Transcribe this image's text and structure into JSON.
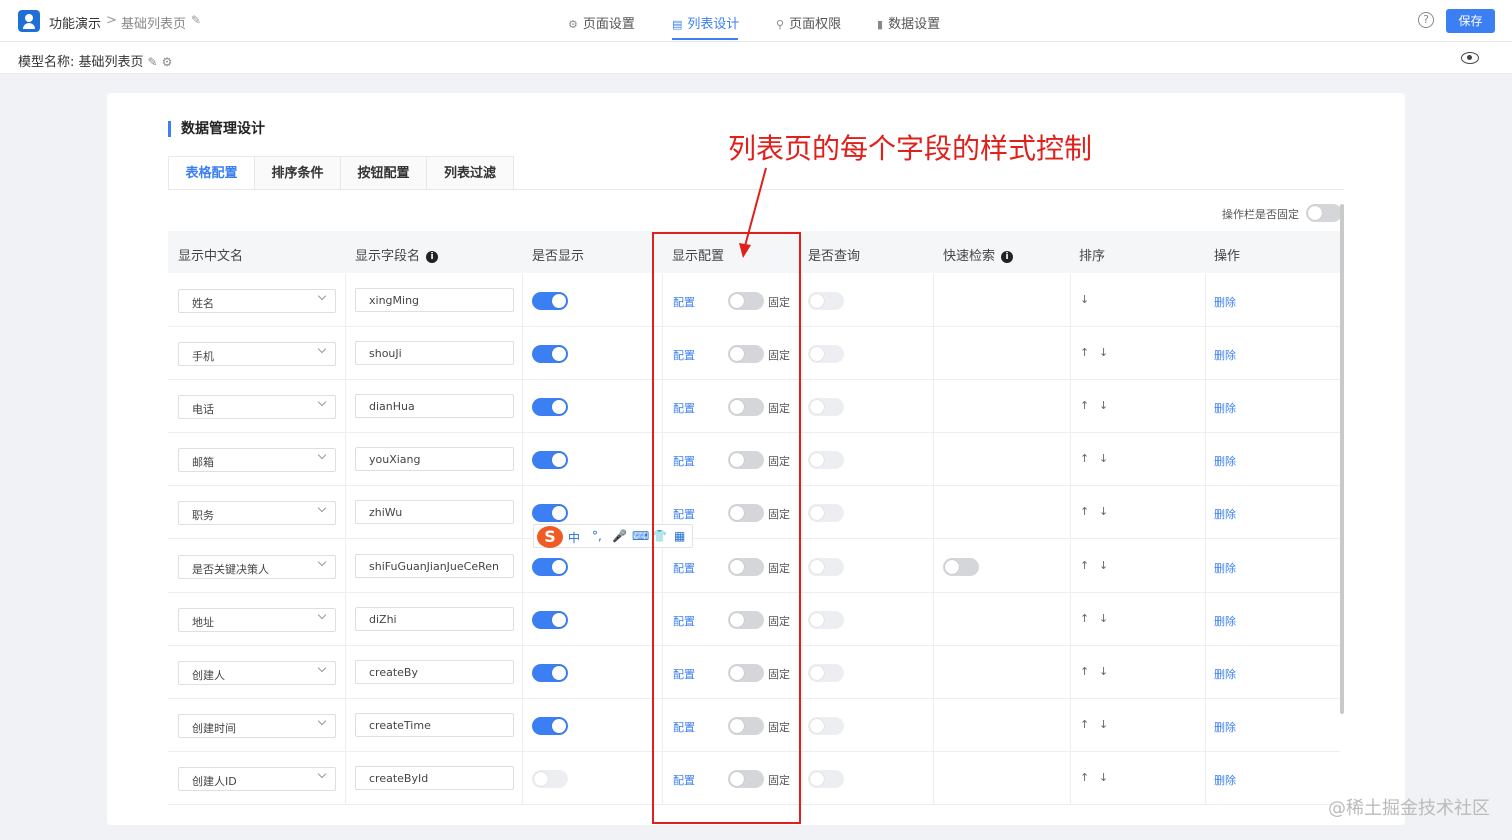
{
  "topbar": {
    "app_name": "功能演示",
    "separator": ">",
    "page_name": "基础列表页",
    "edit_icon": "✎",
    "tabs": [
      {
        "label": "页面设置",
        "icon": "⚙"
      },
      {
        "label": "列表设计",
        "icon": "▤"
      },
      {
        "label": "页面权限",
        "icon": "⚲"
      },
      {
        "label": "数据设置",
        "icon": "▮"
      }
    ],
    "help_icon": "?",
    "save_label": "保存"
  },
  "subbar": {
    "model_label": "模型名称: 基础列表页",
    "edit_icon": "✎",
    "settings_icon": "⚙"
  },
  "section": {
    "title": "数据管理设计",
    "tabs": [
      "表格配置",
      "排序条件",
      "按钮配置",
      "列表过滤"
    ],
    "fix_toggle_label": "操作栏是否固定"
  },
  "table": {
    "headers": [
      "显示中文名",
      "显示字段名",
      "是否显示",
      "显示配置",
      "是否查询",
      "快速检索",
      "排序",
      "操作"
    ],
    "config_link": "配置",
    "fixed_label": "固定",
    "delete_label": "删除",
    "up_arrow": "↑",
    "down_arrow": "↓",
    "rows": [
      {
        "cn": "姓名",
        "field": "xingMing",
        "show": true,
        "quick": false,
        "up": false
      },
      {
        "cn": "手机",
        "field": "shouJi",
        "show": true,
        "quick": false,
        "up": true
      },
      {
        "cn": "电话",
        "field": "dianHua",
        "show": true,
        "quick": false,
        "up": true
      },
      {
        "cn": "邮箱",
        "field": "youXiang",
        "show": true,
        "quick": false,
        "up": true
      },
      {
        "cn": "职务",
        "field": "zhiWu",
        "show": true,
        "quick": false,
        "up": true
      },
      {
        "cn": "是否关键决策人",
        "field": "shiFuGuanJianJueCeRen",
        "show": true,
        "quick": true,
        "up": true
      },
      {
        "cn": "地址",
        "field": "diZhi",
        "show": true,
        "quick": false,
        "up": true
      },
      {
        "cn": "创建人",
        "field": "createBy",
        "show": true,
        "quick": false,
        "up": true
      },
      {
        "cn": "创建时间",
        "field": "createTime",
        "show": true,
        "quick": false,
        "up": true
      },
      {
        "cn": "创建人ID",
        "field": "createById",
        "show": false,
        "quick": false,
        "up": true
      }
    ]
  },
  "annotation": {
    "text": "列表页的每个字段的样式控制",
    "color": "#e0201b"
  },
  "ime": {
    "logo": "S",
    "items": [
      "中",
      "°,",
      "🎤",
      "⌨",
      "👕",
      "▦"
    ]
  },
  "watermark": "@稀土掘金技术社区"
}
